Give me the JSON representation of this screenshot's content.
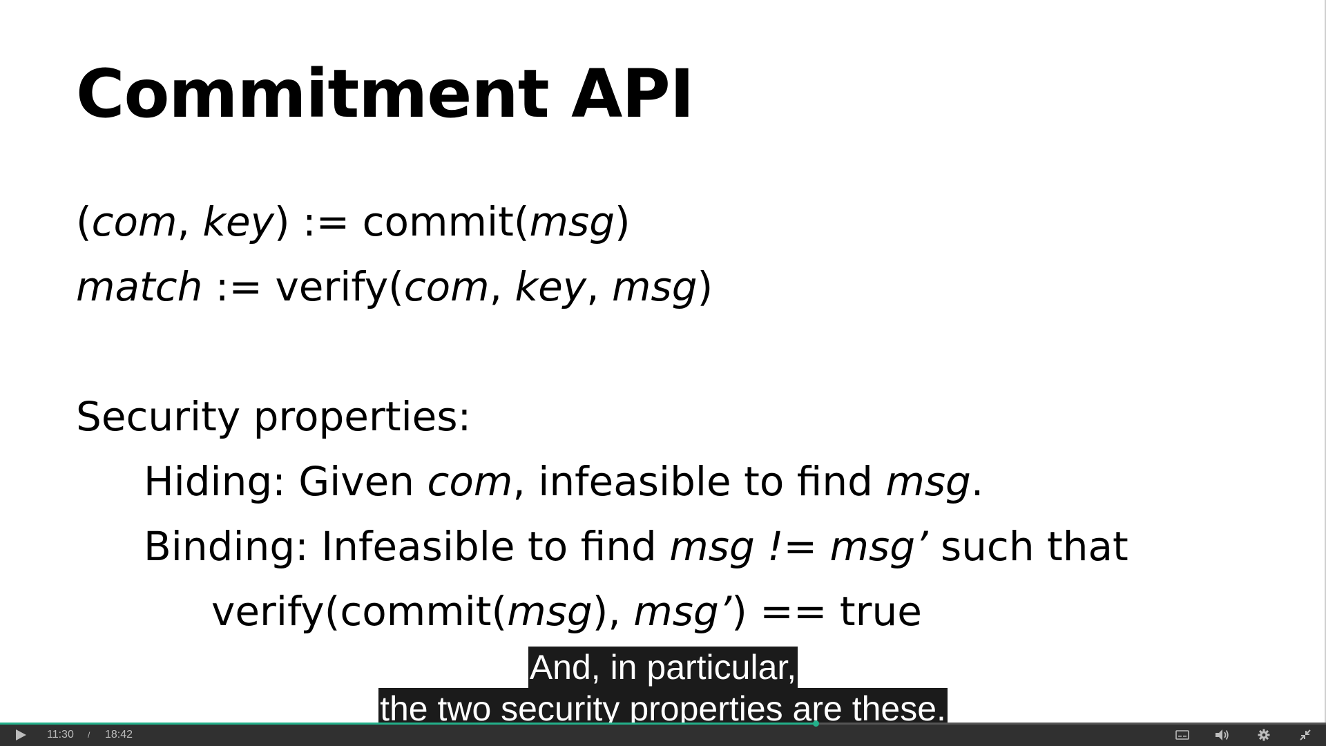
{
  "slide": {
    "title": "Commitment API",
    "commit_line": {
      "open": "(",
      "com": "com",
      "comma": ", ",
      "key": "key",
      "rest": ") := commit(",
      "msg": "msg",
      "close": ")"
    },
    "verify_line": {
      "match": "match",
      "rest": " := verify(",
      "com": "com",
      "c1": ", ",
      "key": "key",
      "c2": ", ",
      "msg": "msg",
      "close": ")"
    },
    "security_heading": "Security properties:",
    "hiding_line": {
      "label": "Hiding:  Given ",
      "com": "com",
      "rest": ", infeasible to find ",
      "msg": "msg",
      "end": "."
    },
    "binding_line": {
      "label": "Binding: Infeasible to find ",
      "msg1": "msg",
      "neq": " != ",
      "msg2": "msg’",
      "rest": " such that"
    },
    "verify2_line": {
      "a": "verify(commit(",
      "msg1": "msg",
      "b": "), ",
      "msg2": "msg’",
      "c": ") == true"
    }
  },
  "captions": {
    "line1": "And, in particular,",
    "line2": "the two security properties are these."
  },
  "player": {
    "current_time": "11:30",
    "separator": "/",
    "duration": "18:42",
    "progress": 0.615,
    "accent_color": "#23b08a",
    "icons": {
      "play": "play-icon",
      "captions": "captions-icon",
      "volume": "volume-icon",
      "settings": "gear-icon",
      "fullscreen": "exit-fullscreen-icon"
    }
  }
}
